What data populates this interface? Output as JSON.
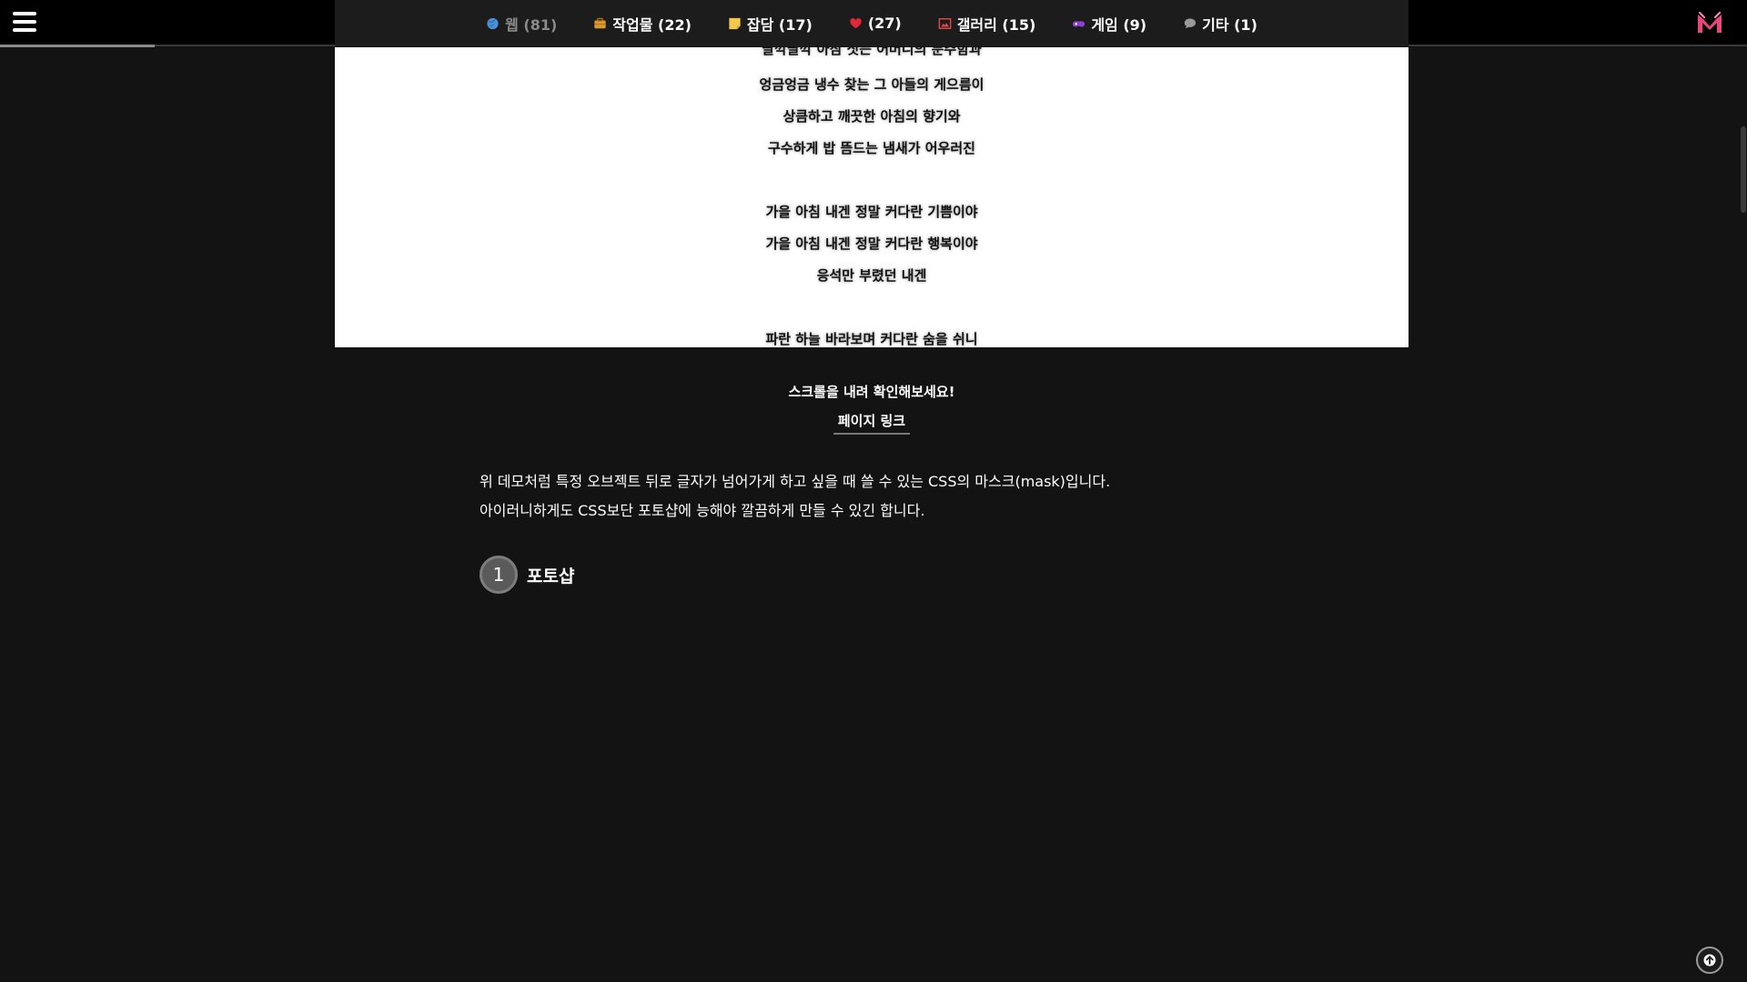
{
  "nav": {
    "menu_icon": "hamburger-icon",
    "logo_icon": "m-logo-icon",
    "categories": [
      {
        "label": "웹 (81)",
        "icon": "globe-icon",
        "color": "#4a90d9"
      },
      {
        "label": "작업물 (22)",
        "icon": "briefcase-icon",
        "color": "#d99a2b"
      },
      {
        "label": "잡담 (17)",
        "icon": "note-icon",
        "color": "#f2c94c"
      },
      {
        "label": "(27)",
        "icon": "heart-icon",
        "color": "#e0283a"
      },
      {
        "label": "갤러리 (15)",
        "icon": "picture-icon",
        "color": "#e04a4a"
      },
      {
        "label": "게임 (9)",
        "icon": "gamepad-icon",
        "color": "#8e3fd6"
      },
      {
        "label": "기타 (1)",
        "icon": "speech-bubble-icon",
        "color": "#9a9a9a"
      }
    ]
  },
  "demo": {
    "lines": [
      "딸깍딸깍 아침 짓는 어머니의 분주함과",
      "엉금엉금 냉수 찾는 그 아들의 게으름이",
      "상큼하고 깨끗한 아침의 향기와",
      "구수하게 밥 뜸드는 냄새가 어우러진",
      "가을 아침 내겐 정말 커다란 기쁨이야",
      "가을 아침 내겐 정말 커다란 행복이야",
      "응석만 부렸던 내겐",
      "파란 하늘 바라보며 커다란 숨을 쉬니"
    ]
  },
  "article": {
    "caption": "스크롤을 내려 확인해보세요!",
    "page_link": "페이지 링크",
    "paragraph_lines": [
      "위 데모처럼 특정 오브젝트 뒤로 글자가 넘어가게 하고 싶을 때 쓸 수 있는 CSS의 마스크(mask)입니다.",
      "아이러니하게도 CSS보단 포토샵에 능해야 깔끔하게 만들 수 있긴 합니다."
    ],
    "section": {
      "number": "1",
      "title": "포토샵"
    }
  },
  "ui": {
    "scroll_top_icon": "arrow-up-icon",
    "accent_colors": {
      "brand": "#e8477e",
      "background": "#131313"
    }
  }
}
